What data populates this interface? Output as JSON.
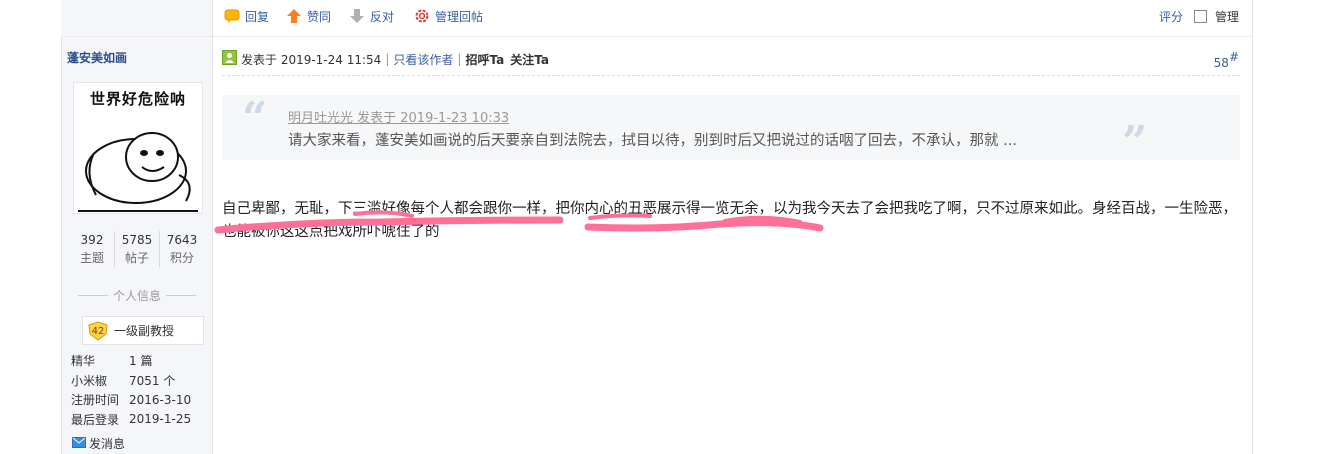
{
  "toolbar": {
    "reply": "回复",
    "like": "赞同",
    "oppose": "反对",
    "manage_reply": "管理回帖",
    "rate": "评分",
    "manage": "管理"
  },
  "author": {
    "name": "蓬安美如画",
    "avatar_caption": "世界好危险呐",
    "stats": [
      {
        "value": "392",
        "label": "主题"
      },
      {
        "value": "5785",
        "label": "帖子"
      },
      {
        "value": "7643",
        "label": "积分"
      }
    ],
    "section_title": "个人信息",
    "rank_level": "42",
    "rank_title": "一级副教授",
    "info": [
      {
        "key": "精华",
        "value": "1 篇"
      },
      {
        "key": "小米椒",
        "value": "7051 个"
      },
      {
        "key": "注册时间",
        "value": "2016-3-10"
      },
      {
        "key": "最后登录",
        "value": "2019-1-25"
      }
    ],
    "send_message": "发消息"
  },
  "post": {
    "posted_at": "发表于 2019-1-24 11:54",
    "only_author": "只看该作者",
    "greet": "招呼Ta",
    "follow": "关注Ta",
    "floor": "58",
    "floor_mark": "#",
    "quote_header": "明月吐光光 发表于 2019-1-23 10:33",
    "quote_text": "请大家来看，蓬安美如画说的后天要亲自到法院去，拭目以待，别到时后又把说过的话咽了回去，不承认，那就 ...",
    "content": "自己卑鄙，无耻，下三滥好像每个人都会跟你一样，把你内心的丑恶展示得一览无余，以为我今天去了会把我吃了啊，只不过原来如此。身经百战，一生险恶，也能被你这这点把戏所吓唬住了的"
  },
  "colors": {
    "link": "#3a5e9e",
    "highlight_marker": "#ff6f96",
    "sidebar_bg": "#f4f6f9"
  }
}
